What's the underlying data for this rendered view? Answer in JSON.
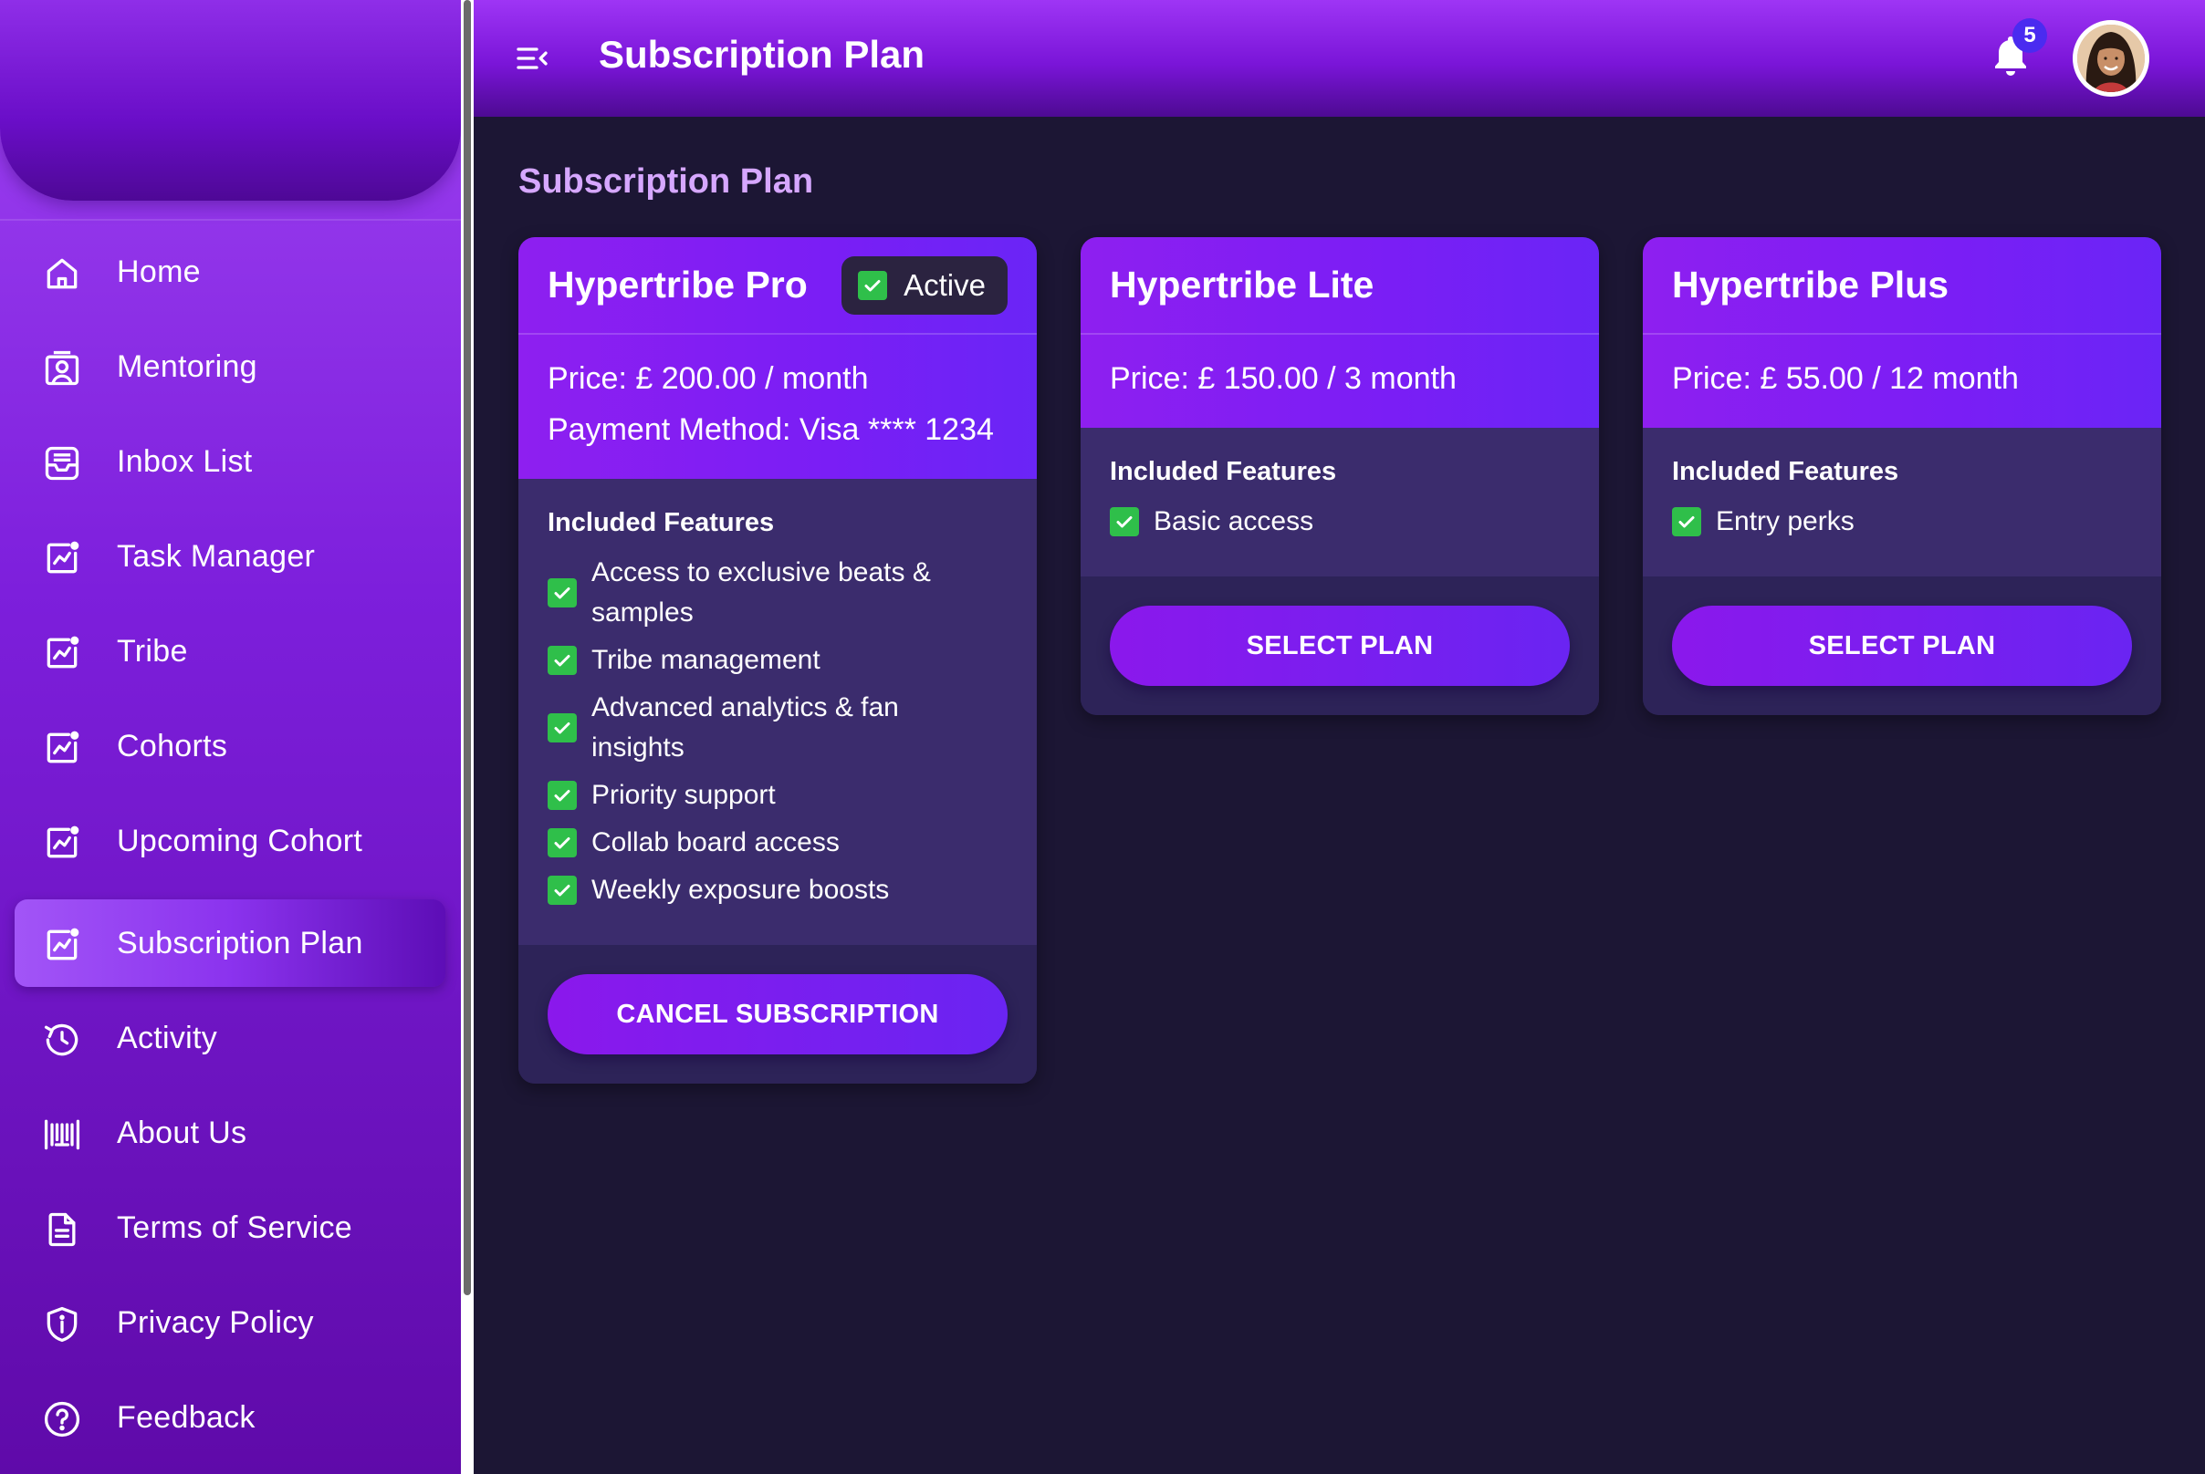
{
  "header": {
    "title": "Subscription Plan",
    "notifications_count": "5"
  },
  "sidebar": {
    "items": [
      {
        "label": "Home",
        "icon": "home-icon"
      },
      {
        "label": "Mentoring",
        "icon": "mentoring-icon"
      },
      {
        "label": "Inbox List",
        "icon": "inbox-icon"
      },
      {
        "label": "Task Manager",
        "icon": "chart-icon"
      },
      {
        "label": "Tribe",
        "icon": "chart-icon"
      },
      {
        "label": "Cohorts",
        "icon": "chart-icon"
      },
      {
        "label": "Upcoming Cohort",
        "icon": "chart-icon"
      },
      {
        "label": "Subscription Plan",
        "icon": "chart-icon",
        "active": true
      },
      {
        "label": "Activity",
        "icon": "history-icon"
      },
      {
        "label": "About Us",
        "icon": "barcode-icon"
      },
      {
        "label": "Terms of Service",
        "icon": "document-icon"
      },
      {
        "label": "Privacy Policy",
        "icon": "shield-icon"
      },
      {
        "label": "Feedback",
        "icon": "help-circle-icon"
      }
    ]
  },
  "main": {
    "section_title": "Subscription Plan",
    "plans": [
      {
        "name": "Hypertribe Pro",
        "status": "Active",
        "price": "Price: £ 200.00 / month",
        "payment_method": "Payment Method: Visa **** 1234",
        "features_title": "Included Features",
        "features": [
          "Access to exclusive beats &",
          "samples",
          "Tribe management",
          "Advanced analytics & fan",
          "insights",
          "Priority support",
          "Collab board access",
          "Weekly exposure boosts"
        ],
        "button": "CANCEL SUBSCRIPTION"
      },
      {
        "name": "Hypertribe Lite",
        "price": "Price: £ 150.00 / 3 month",
        "features_title": "Included Features",
        "features": [
          "Basic access"
        ],
        "button": "SELECT PLAN"
      },
      {
        "name": "Hypertribe Plus",
        "price": "Price: £ 55.00 / 12 month",
        "features_title": "Included Features",
        "features": [
          "Entry perks"
        ],
        "button": "SELECT PLAN"
      }
    ]
  },
  "colors": {
    "accent": "#7a1ef5",
    "check": "#2fbf4a",
    "background": "#1c1634",
    "badge": "#4a2bf0"
  }
}
